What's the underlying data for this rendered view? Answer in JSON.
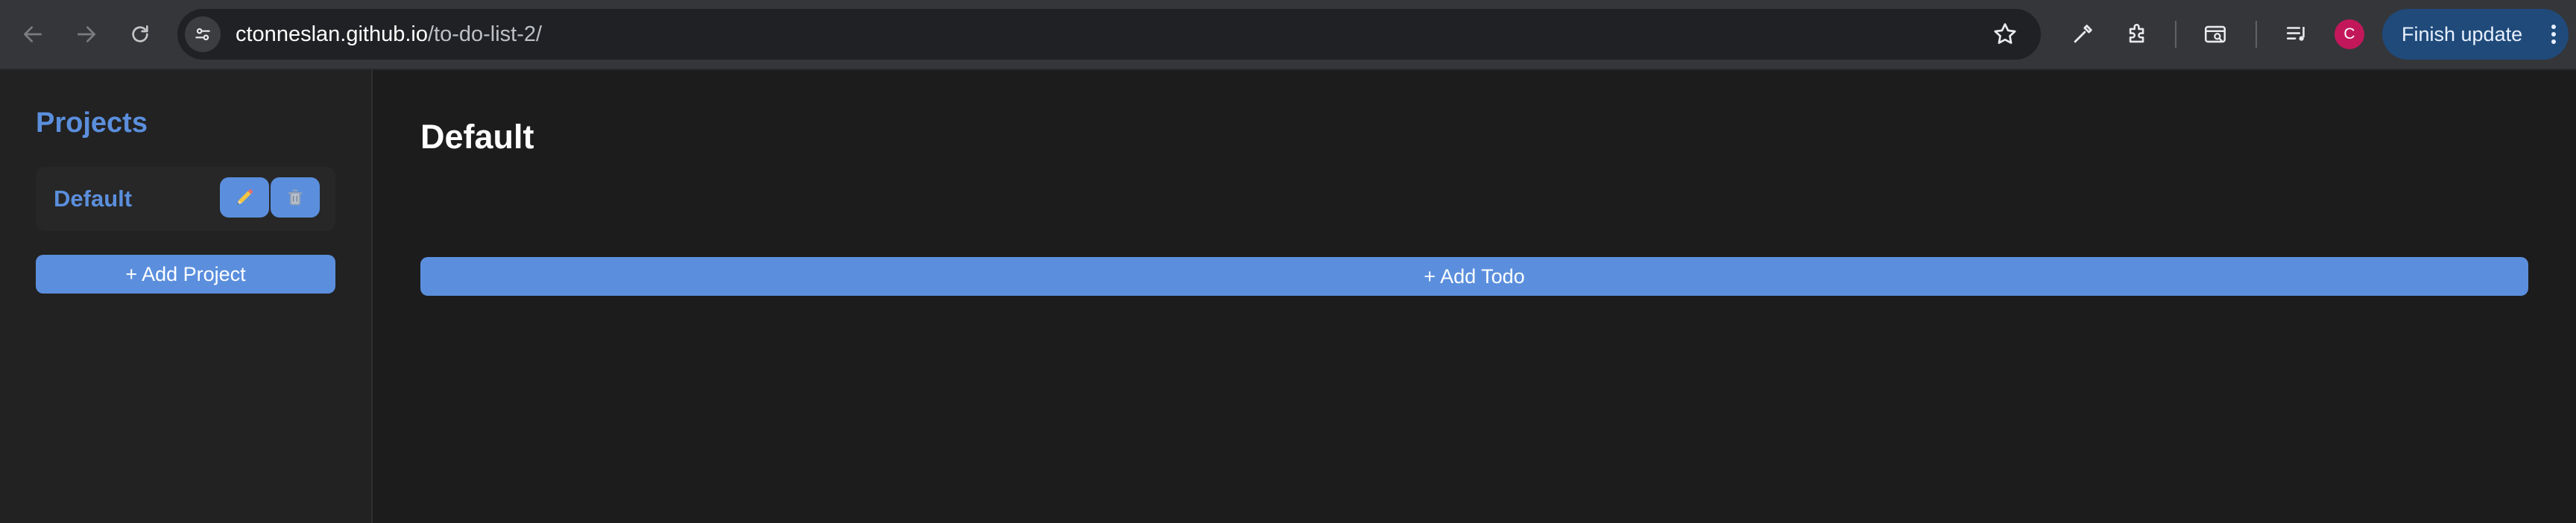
{
  "browser": {
    "url_host": "ctonneslan.github.io",
    "url_path": "/to-do-list-2/",
    "profile_initial": "C",
    "finish_update_label": "Finish update",
    "accent": "#5b8fdd"
  },
  "sidebar": {
    "title": "Projects",
    "projects": [
      {
        "name": "Default",
        "edit_icon": "pencil-icon",
        "delete_icon": "trash-icon"
      }
    ],
    "add_project_label": "+ Add Project"
  },
  "main": {
    "title": "Default",
    "add_todo_label": "+ Add Todo"
  }
}
